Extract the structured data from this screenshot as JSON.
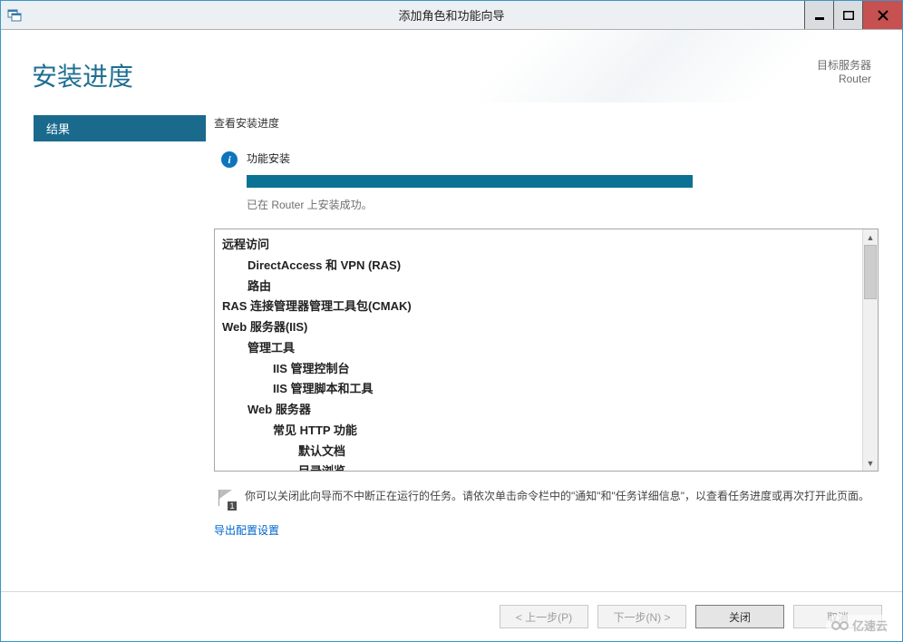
{
  "window": {
    "title": "添加角色和功能向导"
  },
  "header": {
    "page_title": "安装进度",
    "dest_label": "目标服务器",
    "dest_value": "Router"
  },
  "sidebar": {
    "items": [
      {
        "label": "结果"
      }
    ]
  },
  "content": {
    "section_label": "查看安装进度",
    "status_title": "功能安装",
    "status_message": "已在 Router 上安装成功。",
    "features": [
      {
        "level": 0,
        "text": "远程访问"
      },
      {
        "level": 1,
        "text": "DirectAccess 和 VPN (RAS)"
      },
      {
        "level": 1,
        "text": "路由"
      },
      {
        "level": 0,
        "text": "RAS 连接管理器管理工具包(CMAK)"
      },
      {
        "level": 0,
        "text": "Web 服务器(IIS)"
      },
      {
        "level": 1,
        "text": "管理工具"
      },
      {
        "level": 2,
        "text": "IIS 管理控制台"
      },
      {
        "level": 2,
        "text": "IIS 管理脚本和工具"
      },
      {
        "level": 1,
        "text": "Web 服务器"
      },
      {
        "level": 2,
        "text": "常见 HTTP 功能"
      },
      {
        "level": 3,
        "text": "默认文档"
      },
      {
        "level": 3,
        "text": "目录浏览"
      }
    ],
    "note_text": "你可以关闭此向导而不中断正在运行的任务。请依次单击命令栏中的\"通知\"和\"任务详细信息\"，以查看任务进度或再次打开此页面。",
    "note_badge": "1",
    "export_link": "导出配置设置"
  },
  "footer": {
    "prev": "< 上一步(P)",
    "next": "下一步(N) >",
    "close": "关闭",
    "cancel": "取消"
  },
  "watermark": "亿速云"
}
